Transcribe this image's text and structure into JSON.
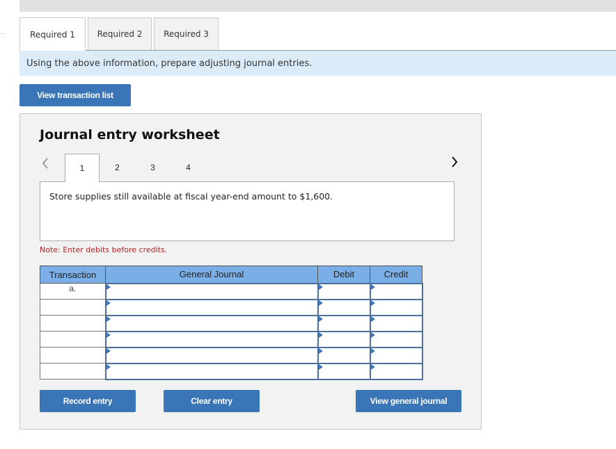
{
  "tabs": [
    {
      "label": "Required 1",
      "active": true
    },
    {
      "label": "Required 2",
      "active": false
    },
    {
      "label": "Required 3",
      "active": false
    }
  ],
  "instruction": "Using the above information, prepare adjusting journal entries.",
  "view_transaction_list_label": "View transaction list",
  "worksheet": {
    "title": "Journal entry worksheet",
    "steps": [
      "1",
      "2",
      "3",
      "4"
    ],
    "active_step": "1",
    "description": "Store supplies still available at fiscal year-end amount to $1,600.",
    "note": "Note: Enter debits before credits.",
    "prev_icon": "chevron-left-icon",
    "next_icon": "chevron-right-icon",
    "table": {
      "headers": [
        "Transaction",
        "General Journal",
        "Debit",
        "Credit"
      ],
      "rows": [
        {
          "transaction": "a.",
          "account": "",
          "debit": "",
          "credit": ""
        },
        {
          "transaction": "",
          "account": "",
          "debit": "",
          "credit": ""
        },
        {
          "transaction": "",
          "account": "",
          "debit": "",
          "credit": ""
        },
        {
          "transaction": "",
          "account": "",
          "debit": "",
          "credit": ""
        },
        {
          "transaction": "",
          "account": "",
          "debit": "",
          "credit": ""
        },
        {
          "transaction": "",
          "account": "",
          "debit": "",
          "credit": ""
        }
      ]
    },
    "buttons": {
      "record": "Record entry",
      "clear": "Clear entry",
      "view_general_journal": "View general journal"
    }
  },
  "colors": {
    "button": "#3a75b8",
    "table_header": "#7aaee6",
    "instruction_bg": "#dbebf8",
    "note": "#b22222"
  }
}
